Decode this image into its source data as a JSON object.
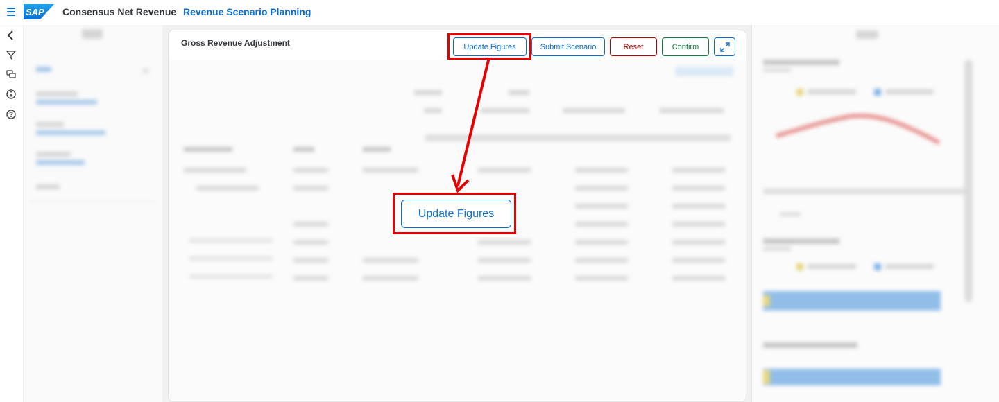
{
  "header": {
    "logo_text": "SAP",
    "app_title": "Consensus Net Revenue",
    "app_subtitle": "Revenue Scenario Planning"
  },
  "card": {
    "title": "Gross Revenue Adjustment",
    "buttons": {
      "update_figures": "Update Figures",
      "submit_scenario": "Submit Scenario",
      "reset": "Reset",
      "confirm": "Confirm"
    }
  },
  "callout": {
    "label": "Update Figures"
  },
  "colors": {
    "brand_blue": "#0a6ed1",
    "reset_red": "#bb0000",
    "confirm_green": "#107e3e",
    "highlight_red": "#e60000"
  }
}
